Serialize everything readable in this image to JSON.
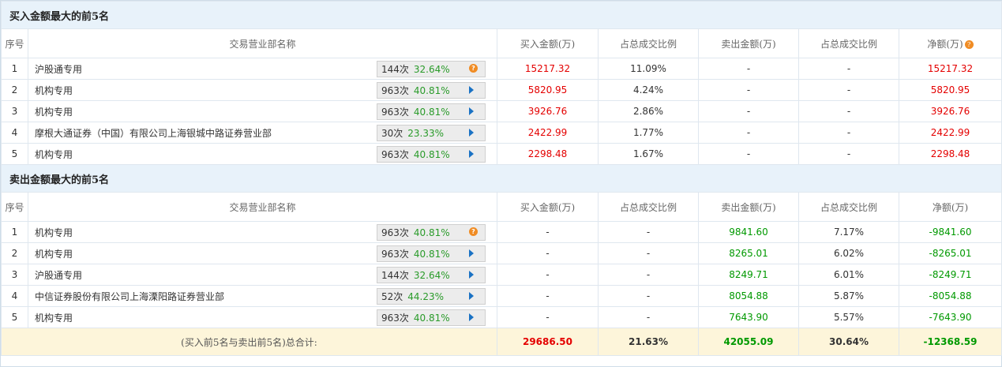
{
  "buy_section": {
    "title": "买入金额最大的前5名",
    "headers": [
      "序号",
      "交易营业部名称",
      "买入金额(万)",
      "占总成交比例",
      "卖出金额(万)",
      "占总成交比例",
      "净额(万)"
    ],
    "rows": [
      {
        "idx": "1",
        "name": "沪股通专用",
        "count": "144次",
        "rate": "32.64%",
        "icon": "info-icon",
        "buy": "15217.32",
        "buy_pct": "11.09%",
        "sell": "-",
        "sell_pct": "-",
        "net": "15217.32"
      },
      {
        "idx": "2",
        "name": "机构专用",
        "count": "963次",
        "rate": "40.81%",
        "icon": "play-icon",
        "buy": "5820.95",
        "buy_pct": "4.24%",
        "sell": "-",
        "sell_pct": "-",
        "net": "5820.95"
      },
      {
        "idx": "3",
        "name": "机构专用",
        "count": "963次",
        "rate": "40.81%",
        "icon": "play-icon",
        "buy": "3926.76",
        "buy_pct": "2.86%",
        "sell": "-",
        "sell_pct": "-",
        "net": "3926.76"
      },
      {
        "idx": "4",
        "name": "摩根大通证券（中国）有限公司上海银城中路证券营业部",
        "count": "30次",
        "rate": "23.33%",
        "icon": "play-icon",
        "buy": "2422.99",
        "buy_pct": "1.77%",
        "sell": "-",
        "sell_pct": "-",
        "net": "2422.99"
      },
      {
        "idx": "5",
        "name": "机构专用",
        "count": "963次",
        "rate": "40.81%",
        "icon": "play-icon",
        "buy": "2298.48",
        "buy_pct": "1.67%",
        "sell": "-",
        "sell_pct": "-",
        "net": "2298.48"
      }
    ]
  },
  "sell_section": {
    "title": "卖出金额最大的前5名",
    "headers": [
      "序号",
      "交易营业部名称",
      "买入金额(万)",
      "占总成交比例",
      "卖出金额(万)",
      "占总成交比例",
      "净额(万)"
    ],
    "rows": [
      {
        "idx": "1",
        "name": "机构专用",
        "count": "963次",
        "rate": "40.81%",
        "icon": "info-icon",
        "buy": "-",
        "buy_pct": "-",
        "sell": "9841.60",
        "sell_pct": "7.17%",
        "net": "-9841.60"
      },
      {
        "idx": "2",
        "name": "机构专用",
        "count": "963次",
        "rate": "40.81%",
        "icon": "play-icon",
        "buy": "-",
        "buy_pct": "-",
        "sell": "8265.01",
        "sell_pct": "6.02%",
        "net": "-8265.01"
      },
      {
        "idx": "3",
        "name": "沪股通专用",
        "count": "144次",
        "rate": "32.64%",
        "icon": "play-icon",
        "buy": "-",
        "buy_pct": "-",
        "sell": "8249.71",
        "sell_pct": "6.01%",
        "net": "-8249.71"
      },
      {
        "idx": "4",
        "name": "中信证券股份有限公司上海溧阳路证券营业部",
        "count": "52次",
        "rate": "44.23%",
        "icon": "play-icon",
        "buy": "-",
        "buy_pct": "-",
        "sell": "8054.88",
        "sell_pct": "5.87%",
        "net": "-8054.88"
      },
      {
        "idx": "5",
        "name": "机构专用",
        "count": "963次",
        "rate": "40.81%",
        "icon": "play-icon",
        "buy": "-",
        "buy_pct": "-",
        "sell": "7643.90",
        "sell_pct": "5.57%",
        "net": "-7643.90"
      }
    ]
  },
  "total": {
    "label": "(买入前5名与卖出前5名)总合计:",
    "buy": "29686.50",
    "buy_pct": "21.63%",
    "sell": "42055.09",
    "sell_pct": "30.64%",
    "net": "-12368.59"
  },
  "info_glyph": "?",
  "colors": {
    "buy": "#e40000",
    "sell": "#009900",
    "header_bg": "#e8f2fa",
    "total_bg": "#fdf5da",
    "badge_icon": "#1a72c4",
    "info_icon": "#f08c24"
  }
}
